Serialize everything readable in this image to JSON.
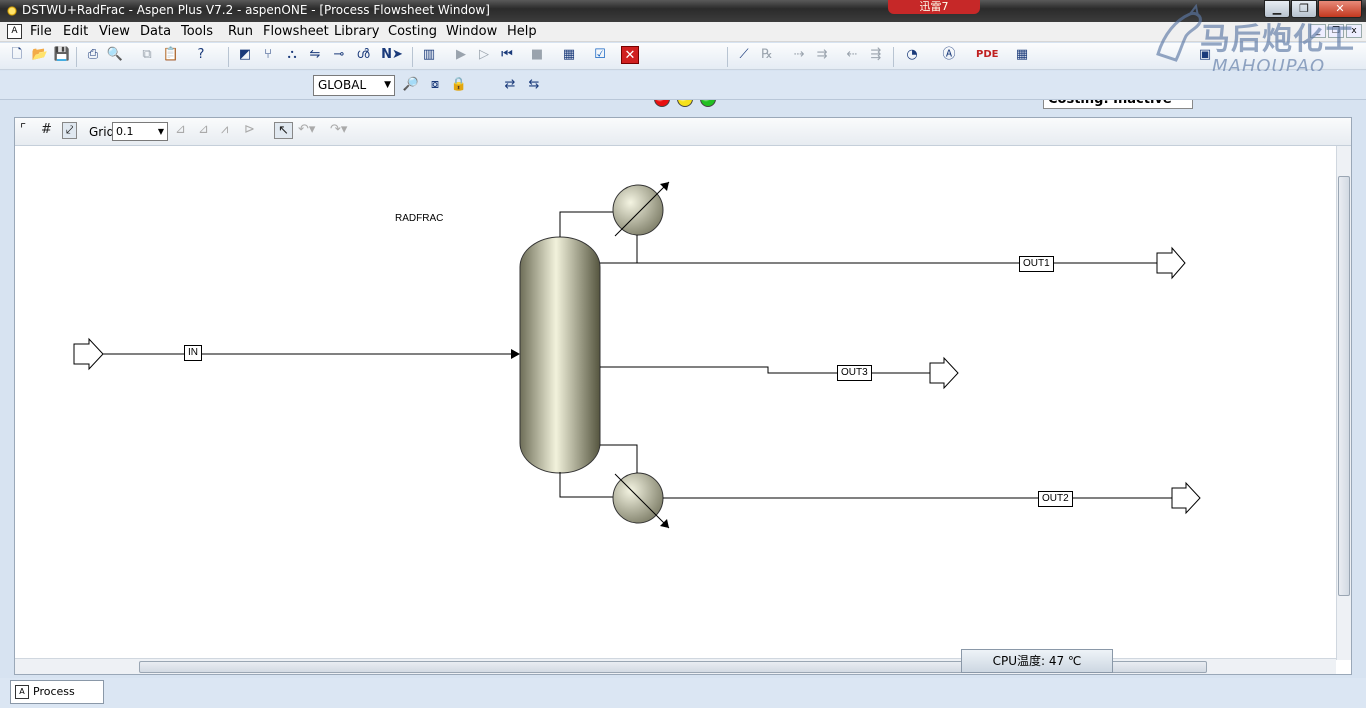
{
  "window": {
    "title": "DSTWU+RadFrac - Aspen Plus V7.2 - aspenONE - [Process Flowsheet Window]",
    "badge": "迅雷7"
  },
  "menu": {
    "items": [
      "File",
      "Edit",
      "View",
      "Data",
      "Tools",
      "Run",
      "Flowsheet",
      "Library",
      "Costing",
      "Window",
      "Help"
    ]
  },
  "toolbar": {
    "costing_status": "Costing: Inactive",
    "global_select": "GLOBAL",
    "run_lights": [
      "#e81010",
      "#f5e11a",
      "#22c022"
    ]
  },
  "watermark": {
    "cn": "马后炮化工",
    "en": "MAHOUPAO"
  },
  "flowsheet_toolbar": {
    "grid_label": "Grid",
    "grid_value": "0.1"
  },
  "flowsheet": {
    "block_name": "RADFRAC",
    "streams": {
      "in": "IN",
      "out1": "OUT1",
      "out2": "OUT2",
      "out3": "OUT3"
    }
  },
  "status": {
    "cpu_temp": "CPU温度: 47 ℃"
  },
  "bottom_tab": {
    "label": "Process Flo..."
  }
}
